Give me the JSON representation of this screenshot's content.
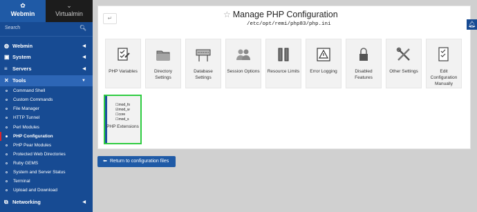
{
  "sidebar": {
    "tabs": {
      "webmin": "Webmin",
      "virtualmin": "Virtualmin"
    },
    "search_placeholder": "Search",
    "categories": {
      "webmin": "Webmin",
      "system": "System",
      "servers": "Servers",
      "tools": "Tools",
      "networking": "Networking"
    },
    "tools_items": [
      "Command Shell",
      "Custom Commands",
      "File Manager",
      "HTTP Tunnel",
      "Perl Modules",
      "PHP Configuration",
      "PHP Pear Modules",
      "Protected Web Directories",
      "Ruby GEMS",
      "System and Server Status",
      "Terminal",
      "Upload and Download"
    ],
    "active_item": "PHP Configuration"
  },
  "main": {
    "title": "Manage PHP Configuration",
    "path": "/etc/opt/remi/php83/php.ini",
    "tiles": [
      {
        "label": "PHP Variables",
        "icon": "edit-form-icon"
      },
      {
        "label": "Directory Settings",
        "icon": "folder-icon"
      },
      {
        "label": "Database Settings",
        "icon": "database-icon"
      },
      {
        "label": "Session Options",
        "icon": "users-icon"
      },
      {
        "label": "Resource Limits",
        "icon": "limits-icon"
      },
      {
        "label": "Error Logging",
        "icon": "warning-icon"
      },
      {
        "label": "Disabled Features",
        "icon": "lock-icon"
      },
      {
        "label": "Other Settings",
        "icon": "tools-icon"
      },
      {
        "label": "Edit Configuration Manually",
        "icon": "edit-document-icon"
      },
      {
        "label": "PHP Extensions",
        "icon": "extensions-list-icon"
      }
    ],
    "extensions_preview": [
      "mod_fo",
      "mod_w",
      "core",
      "mod_s"
    ],
    "return_button": "Return to configuration files"
  },
  "colors": {
    "sidebar_bg": "#174b93",
    "accent": "#1f5aa6",
    "highlight": "#2ecc40",
    "active_marker": "#d9242c"
  }
}
